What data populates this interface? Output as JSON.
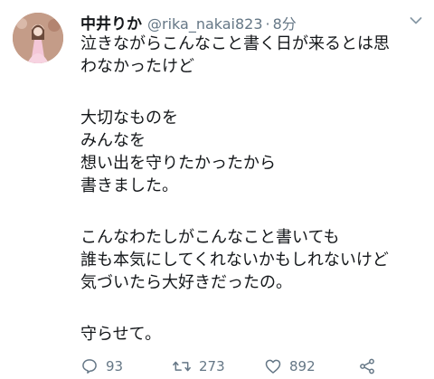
{
  "tweet": {
    "author_name": "中井りか",
    "handle": "@rika_nakai823",
    "separator": "·",
    "time": "8分",
    "lines": [
      "泣きながらこんなこと書く日が来るとは思",
      "わなかったけど",
      "",
      "大切なものを",
      "みんなを",
      "想い出を守りたかったから",
      "書きました。",
      "",
      "こんなわたしがこんなこと書いても",
      "誰も本気にしてくれないかもしれないけど",
      "気づいたら大好きだったの。",
      "",
      "守らせて。"
    ]
  },
  "actions": {
    "reply_icon": "reply-icon",
    "reply_count": "93",
    "retweet_icon": "retweet-icon",
    "retweet_count": "273",
    "like_icon": "heart-icon",
    "like_count": "892",
    "share_icon": "share-icon"
  },
  "colors": {
    "text": "#14171a",
    "secondary": "#657786",
    "background": "#ffffff"
  }
}
